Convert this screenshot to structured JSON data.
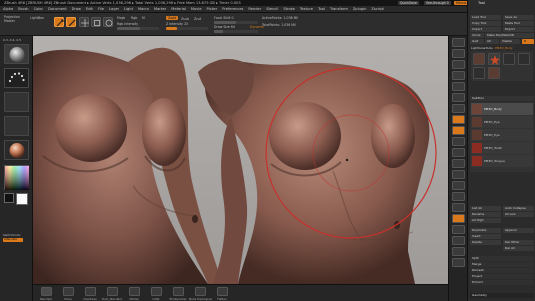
{
  "titlebar": {
    "text": "ZBrush 4R6  [ZBRUSH 4R6]  ZBrush Document  ▸ Active Verts 1,036,296  ▸ Total Verts 1,036,296  ▸ Free Mem 13.879 GB  ▸ Timer 0.003",
    "quicksave": "QuickSave",
    "seethrough": "See-through 0",
    "menus": "Menus",
    "defaultscript": "DefaultZScript"
  },
  "menubar": {
    "items": [
      "Alpha",
      "Brush",
      "Color",
      "Document",
      "Draw",
      "Edit",
      "File",
      "Layer",
      "Light",
      "Macro",
      "Marker",
      "Material",
      "Movie",
      "Picker",
      "Preferences",
      "Render",
      "Stencil",
      "Stroke",
      "Texture",
      "Tool",
      "Transform",
      "Zplugin",
      "Zscript"
    ]
  },
  "shelf": {
    "projection_label": "Projection",
    "master_label": "Master",
    "lightbox_label": "LightBox",
    "mode_buttons": [
      {
        "label": "Edit",
        "active": true
      },
      {
        "label": "Draw",
        "active": true
      },
      {
        "label": "Move",
        "active": false
      },
      {
        "label": "Scale",
        "active": false
      },
      {
        "label": "Rotate",
        "active": false
      }
    ],
    "mrgb": "Mrgb",
    "rgb": "Rgb",
    "m": "M",
    "rgb_intensity": "Rgb Intensity",
    "zadd": "Zadd",
    "zsub": "Zsub",
    "zcut": "Zcut",
    "z_intensity": "Z Intensity 25",
    "focal_shift": "Focal Shift 0",
    "draw_size": "Draw Size 64",
    "dynamic": "Dynamic",
    "active_points": "ActivePoints: 1.036 Mil",
    "total_points": "TotalPoints: 1.036 Mil",
    "accent": "#d9791b"
  },
  "left": {
    "coords": "0.3, 0.4, 0.5",
    "standard_label": "Standard",
    "stroke_label": "DragRect",
    "alpha_label": "Off",
    "texture_label": "Off",
    "material_label": "SkinShade4",
    "gradient_label": "Gradient",
    "switch_color_label": "SwitchColor",
    "alternate_label": "Alternate"
  },
  "canvas": {
    "bg": "#ababab",
    "brush_circle_color": "#c6312c"
  },
  "bottom": {
    "items": [
      "Standard",
      "Move",
      "ClayTubes",
      "Dam_Standard",
      "hPolish",
      "Inflat",
      "TrimDynamic",
      "Move Topological",
      "Flatten"
    ]
  },
  "rightshelf": {
    "buttons": [
      "BPR",
      "SPix 3",
      "Scroll",
      "Zoom",
      "Actual",
      "AAHalf",
      "Persp",
      "Floor",
      "Local",
      "LSym",
      "Gxyz",
      "Frame",
      "Move",
      "Scale",
      "Rotate",
      "Line Fill",
      "PolyF",
      "Transp",
      "Ghost",
      "Solo",
      "Xpose"
    ]
  },
  "tool": {
    "title": "Tool",
    "load_tool": "Load Tool",
    "save_as": "Save As",
    "copy_tool": "Copy Tool",
    "paste_tool": "Paste Tool",
    "import": "Import",
    "export": "Export",
    "clone": "Clone",
    "make_polymesh": "Make PolyMesh3D",
    "goz": "GoZ",
    "all": "All",
    "visible": "Visible",
    "r": "R",
    "lightbox_tools": "Lightbox▸Tools",
    "current_tool": "PM3D_Body",
    "subtool_header": "SubTool",
    "subtools": [
      "PM3D_Body",
      "PM3D_Eye",
      "PM3D_Eye",
      "PM3D_Tooth",
      "PM3D_Tongue"
    ],
    "list_all": "List All",
    "auto_collapse": "Auto Collapse",
    "rename": "Rename",
    "all_low": "All Low",
    "all_high": "All High",
    "duplicate": "Duplicate",
    "append": "Append",
    "insert": "Insert",
    "delete": "Delete",
    "del_other": "Del Other",
    "del_all": "Del All",
    "split": "Split",
    "merge": "Merge",
    "remesh": "Remesh",
    "project": "Project",
    "extract": "Extract",
    "geometry": "Geometry",
    "color_alt": "#c84b26"
  }
}
